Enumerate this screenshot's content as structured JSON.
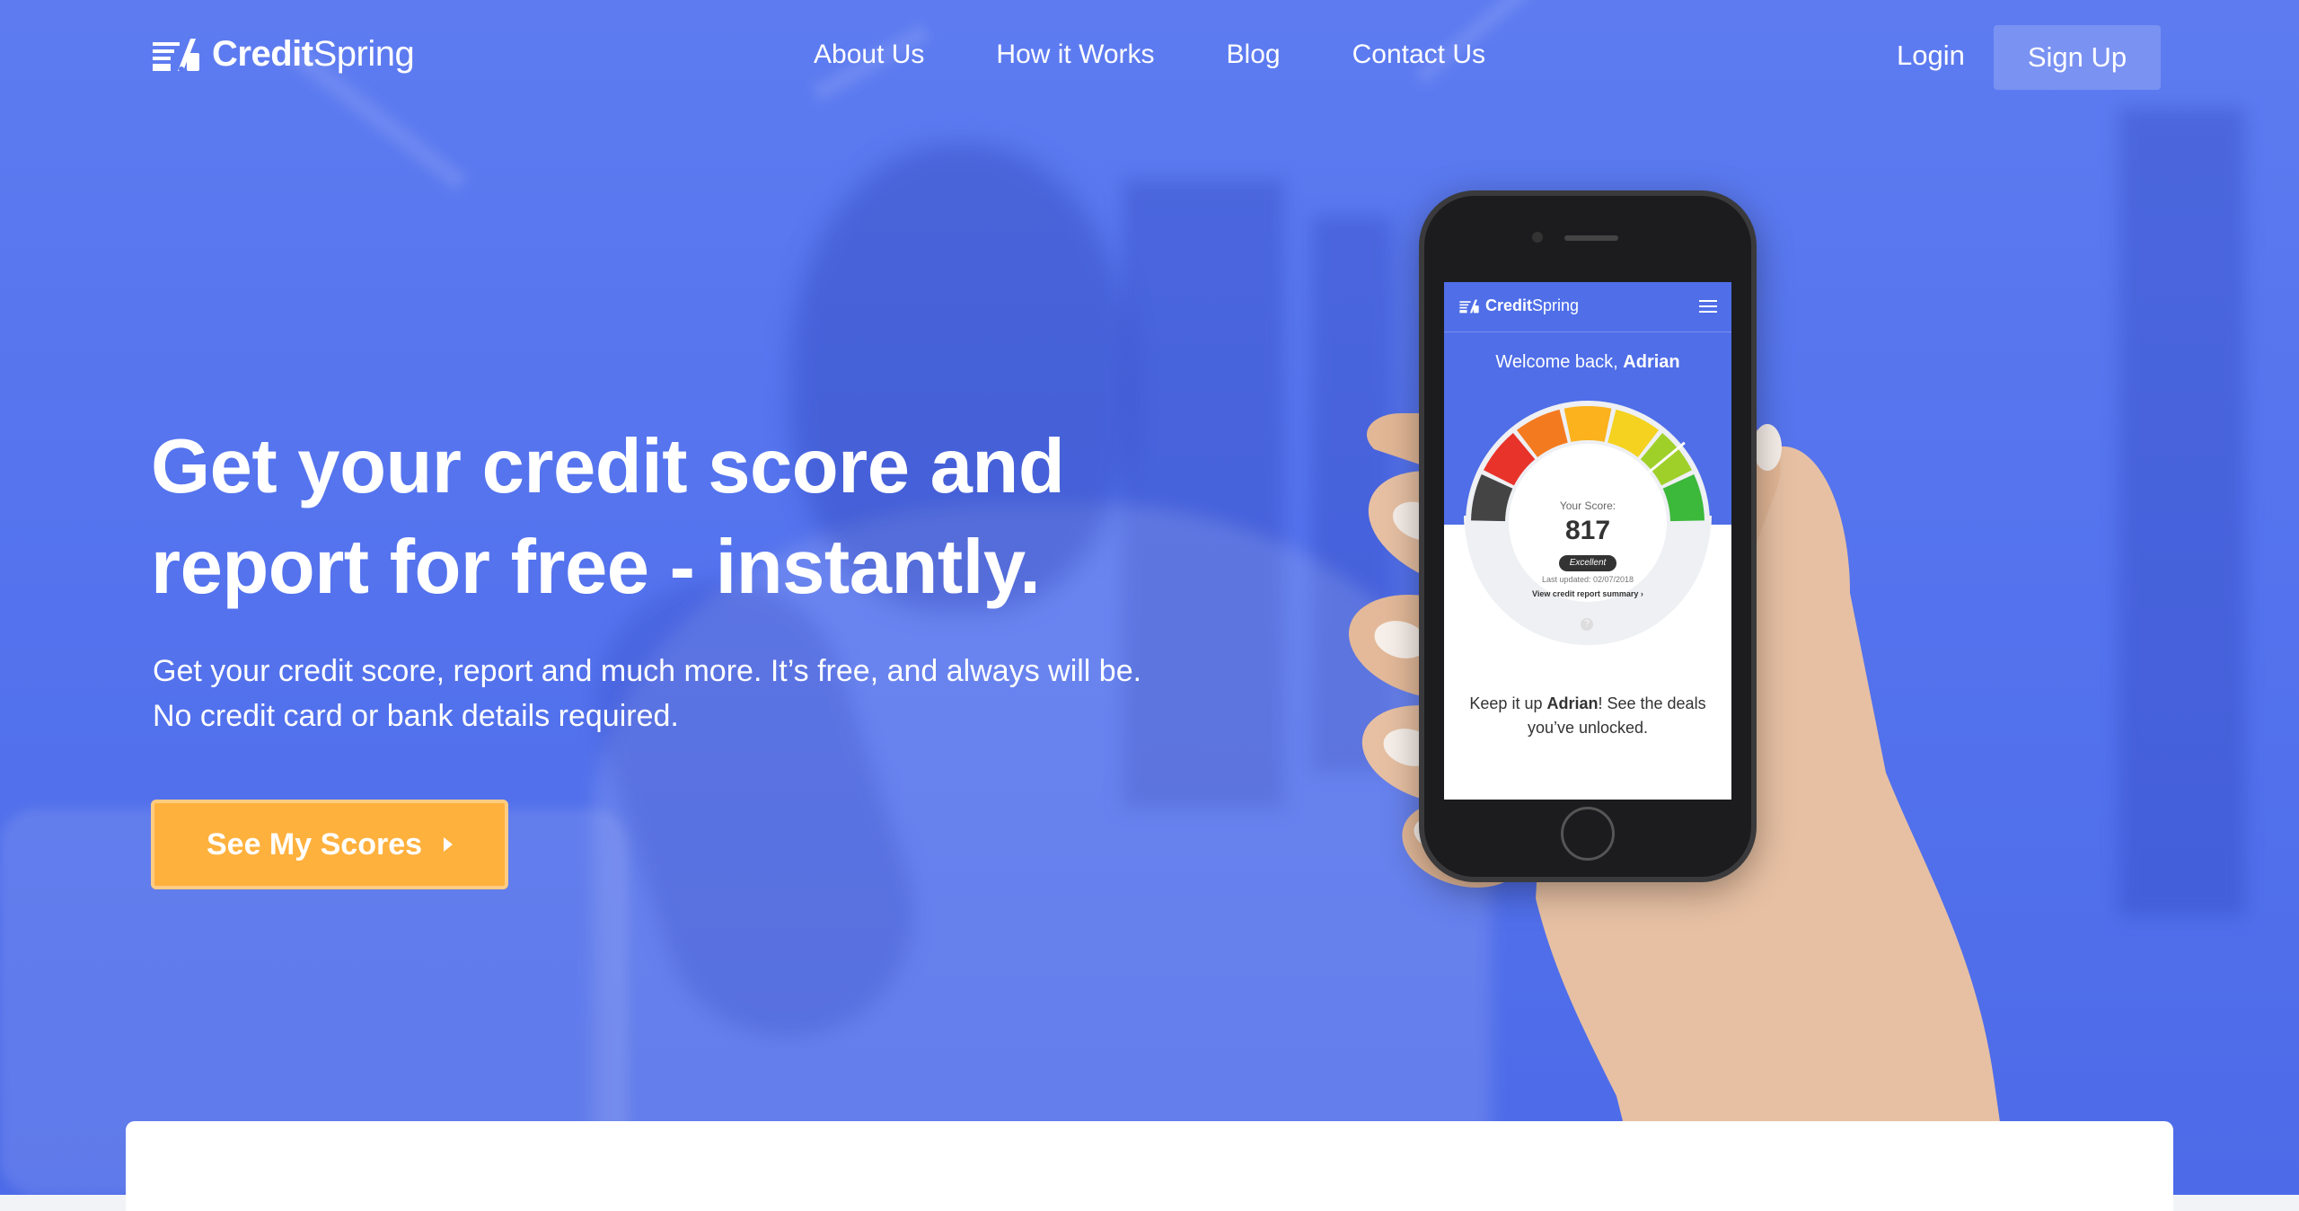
{
  "brand": {
    "name_bold": "Credit",
    "name_light": "Spring"
  },
  "nav": {
    "links": [
      "About Us",
      "How it Works",
      "Blog",
      "Contact Us"
    ],
    "login": "Login",
    "signup": "Sign Up"
  },
  "hero": {
    "title_line1": "Get your credit score and",
    "title_line2": "report for free - instantly.",
    "sub_line1": "Get your credit score, report and much more. It’s free, and always will be.",
    "sub_line2": "No credit card or bank details required.",
    "cta": "See My Scores"
  },
  "phone": {
    "app_name_bold": "Credit",
    "app_name_light": "Spring",
    "welcome_prefix": "Welcome back,",
    "user_name": "Adrian",
    "score_label": "Your Score:",
    "score": "817",
    "score_rating": "Excellent",
    "last_updated": "Last updated: 02/07/2018",
    "view_link": "View credit report summary ›",
    "help": "?",
    "keep_prefix": "Keep it up ",
    "keep_name": "Adrian",
    "keep_suffix": "! See the deals you’ve unlocked."
  },
  "colors": {
    "hero_blue": "#5574ee",
    "cta_orange": "#ffb13e",
    "gauge": [
      "#444444",
      "#e8332a",
      "#f47a20",
      "#fbb21d",
      "#f4d21f",
      "#9fd02a",
      "#3cb83a"
    ]
  }
}
